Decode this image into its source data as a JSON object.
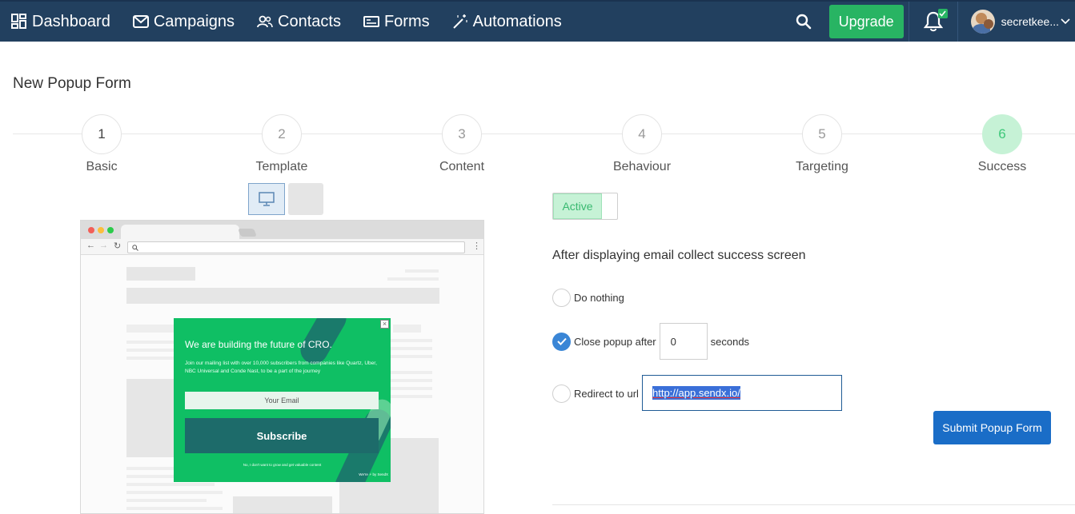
{
  "nav": {
    "items": [
      {
        "label": "Dashboard",
        "icon": "dashboard-icon"
      },
      {
        "label": "Campaigns",
        "icon": "envelope-icon"
      },
      {
        "label": "Contacts",
        "icon": "users-icon"
      },
      {
        "label": "Forms",
        "icon": "form-icon"
      },
      {
        "label": "Automations",
        "icon": "magic-wand-icon"
      }
    ],
    "upgrade_label": "Upgrade",
    "user_name": "secretkee..."
  },
  "page": {
    "title": "New Popup Form"
  },
  "steps": [
    {
      "number": "1",
      "label": "Basic"
    },
    {
      "number": "2",
      "label": "Template"
    },
    {
      "number": "3",
      "label": "Content"
    },
    {
      "number": "4",
      "label": "Behaviour"
    },
    {
      "number": "5",
      "label": "Targeting"
    },
    {
      "number": "6",
      "label": "Success",
      "active": true
    }
  ],
  "preview": {
    "popup_title": "We are building the future of CRO.",
    "popup_desc": "Join our mailing list with over 10,000 subscribers from companies like Quartz, Uber, NBC Universal and Conde Nast, to be a part of the journey",
    "email_placeholder": "Your Email",
    "subscribe_label": "Subscribe",
    "no_thanks": "No, I don't want to grow and get valuable content",
    "brand": "We're ⚡ by SendX",
    "close_symbol": "×"
  },
  "success": {
    "toggle_label": "Active",
    "heading": "After displaying email collect success screen",
    "options": {
      "do_nothing": "Do nothing",
      "close_after": "Close popup after",
      "seconds_value": "0",
      "seconds_label": "seconds",
      "redirect": "Redirect to url",
      "redirect_url": "http://app.sendx.io/"
    },
    "selected": "close_after",
    "submit_label": "Submit Popup Form"
  },
  "colors": {
    "navbar": "#22405f",
    "upgrade": "#28b463",
    "active_step": "#c6f2d6",
    "popup_green": "#0fbf64",
    "submit": "#1a6dc7"
  }
}
